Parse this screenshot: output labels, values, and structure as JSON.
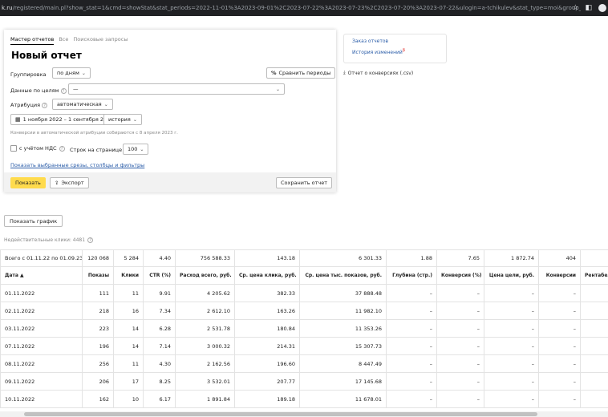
{
  "browser": {
    "url_host": "k.ru",
    "url_rest": "/registered/main.pl?show_stat=1&cmd=showStat&stat_periods=2022-11-01%3A2023-09-01%2C2023-07-22%3A2023-07-23%2C2023-07-20%3A2023-07-22&ulogin=a-tchikulev&stat_type=moi&group_by_date=day&pa...",
    "star_icon": "star-icon",
    "extension_icon": "sidebar-icon"
  },
  "panel": {
    "tabs": [
      "Мастер отчетов",
      "Все",
      "Поисковые запросы"
    ],
    "title": "Новый отчет",
    "grouping_label": "Группировка",
    "grouping_value": "по дням",
    "compare_label": "Сравнить периоды",
    "goals_label": "Данные по целям",
    "goals_value": "—",
    "attribution_label": "Атрибуция",
    "attribution_value": "автоматическая",
    "period_value": "1 ноября 2022 – 1 сентября 2023",
    "history_value": "история",
    "conversions_hint": "Конверсии в автоматической атрибуции собираются с 8 апреля 2023 г.",
    "vat_label": "с учётом НДС",
    "rows_label": "Строк на странице",
    "rows_value": "100",
    "show_filters_link": "Показать выбранные срезы, столбцы и фильтры",
    "show_button": "Показать",
    "export_button": "Экспорт",
    "save_button": "Сохранить отчет"
  },
  "side": {
    "order_reports": "Заказ отчетов",
    "change_history": "История изменений",
    "badge": "β",
    "csv_link": "Отчет о конверсиях (.csv)"
  },
  "graph_button": "Показать график",
  "invalid_clicks": "Недействительные клики: 4481",
  "table": {
    "total_row": [
      "Всего с 01.11.22 по 01.09.23",
      "120 068",
      "5 284",
      "4.40",
      "756 588.33",
      "143.18",
      "6 301.33",
      "1.88",
      "7.65",
      "1 872.74",
      "404",
      "("
    ],
    "headers": [
      "Дата ▲",
      "Показы",
      "Клики",
      "CTR (%)",
      "Расход всего, руб.",
      "Ср. цена клика, руб.",
      "Ср. цена тыс. показов, руб.",
      "Глубина (стр.)",
      "Конверсия (%)",
      "Цена цели, руб.",
      "Конверсии",
      "Рентабельно"
    ],
    "rows": [
      [
        "01.11.2022",
        "111",
        "11",
        "9.91",
        "4 205.62",
        "382.33",
        "37 888.48",
        "–",
        "–",
        "–",
        "–",
        ""
      ],
      [
        "02.11.2022",
        "218",
        "16",
        "7.34",
        "2 612.10",
        "163.26",
        "11 982.10",
        "–",
        "–",
        "–",
        "–",
        ""
      ],
      [
        "03.11.2022",
        "223",
        "14",
        "6.28",
        "2 531.78",
        "180.84",
        "11 353.26",
        "–",
        "–",
        "–",
        "–",
        ""
      ],
      [
        "07.11.2022",
        "196",
        "14",
        "7.14",
        "3 000.32",
        "214.31",
        "15 307.73",
        "–",
        "–",
        "–",
        "–",
        ""
      ],
      [
        "08.11.2022",
        "256",
        "11",
        "4.30",
        "2 162.56",
        "196.60",
        "8 447.49",
        "–",
        "–",
        "–",
        "–",
        ""
      ],
      [
        "09.11.2022",
        "206",
        "17",
        "8.25",
        "3 532.01",
        "207.77",
        "17 145.68",
        "–",
        "–",
        "–",
        "–",
        ""
      ],
      [
        "10.11.2022",
        "162",
        "10",
        "6.17",
        "1 891.84",
        "189.18",
        "11 678.01",
        "–",
        "–",
        "–",
        "–",
        ""
      ]
    ]
  }
}
